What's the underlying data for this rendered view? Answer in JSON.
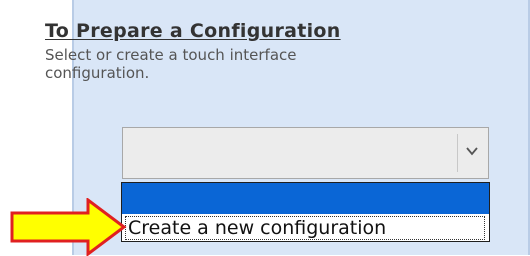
{
  "panel": {
    "title": "To Prepare a Configuration",
    "description": "Select or create a touch interface configuration."
  },
  "select": {
    "selected_value": "",
    "icon": "chevron-down-icon",
    "options": [
      "",
      "Create a new configuration"
    ]
  },
  "annotation": {
    "icon": "right-arrow-icon",
    "fill_color": "#ffff00",
    "stroke_color": "#e02020"
  },
  "colors": {
    "panel_background": "#d9e6f7",
    "highlight": "#0a66d6"
  }
}
